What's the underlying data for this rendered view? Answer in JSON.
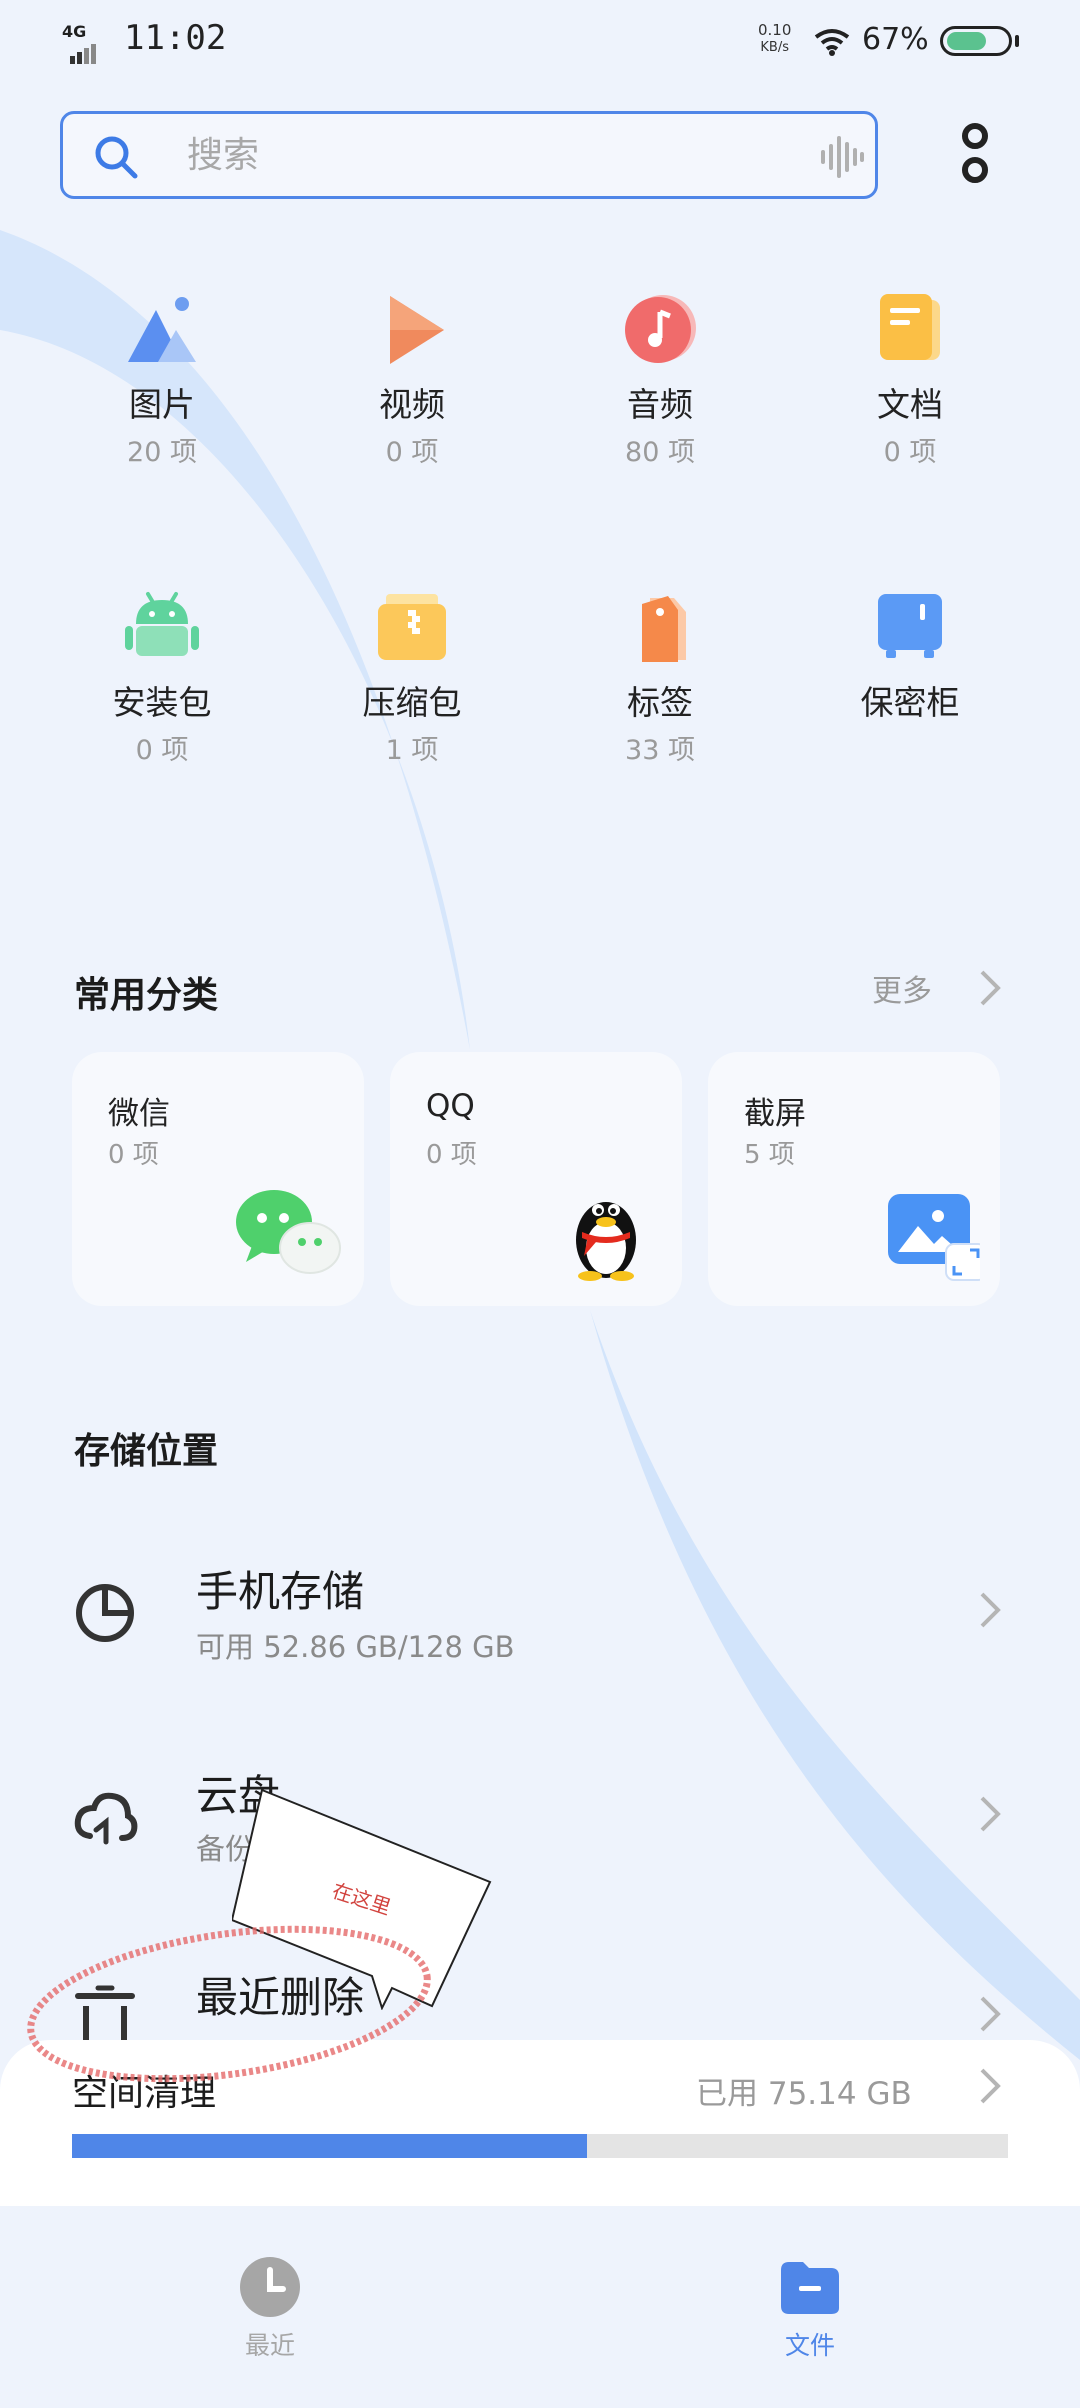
{
  "status_bar": {
    "network": "4G",
    "time": "11:02",
    "speed_value": "0.10",
    "speed_unit": "KB/s",
    "battery_pct": "67%",
    "battery_level": 0.67
  },
  "search": {
    "placeholder": "搜索"
  },
  "categories": [
    {
      "label": "图片",
      "count": "20 项",
      "icon": "image-icon"
    },
    {
      "label": "视频",
      "count": "0 项",
      "icon": "video-icon"
    },
    {
      "label": "音频",
      "count": "80 项",
      "icon": "audio-icon"
    },
    {
      "label": "文档",
      "count": "0 项",
      "icon": "document-icon"
    },
    {
      "label": "安装包",
      "count": "0 项",
      "icon": "android-icon"
    },
    {
      "label": "压缩包",
      "count": "1 项",
      "icon": "zip-icon"
    },
    {
      "label": "标签",
      "count": "33 项",
      "icon": "tag-icon"
    },
    {
      "label": "保密柜",
      "count": "",
      "icon": "safe-icon"
    }
  ],
  "common": {
    "title": "常用分类",
    "more": "更多",
    "cards": [
      {
        "title": "微信",
        "count": "0 项",
        "icon": "wechat-icon"
      },
      {
        "title": "QQ",
        "count": "0 项",
        "icon": "qq-icon"
      },
      {
        "title": "截屏",
        "count": "5 项",
        "icon": "screenshot-icon"
      }
    ]
  },
  "storage": {
    "title": "存储位置",
    "items": [
      {
        "title": "手机存储",
        "subtitle": "可用 52.86 GB/128 GB",
        "icon": "pie-chart-icon"
      },
      {
        "title": "云盘",
        "subtitle": "备份",
        "icon": "cloud-sync-icon"
      },
      {
        "title": "最近删除",
        "subtitle": "",
        "icon": "trash-icon"
      }
    ]
  },
  "cleanup": {
    "title": "空间清理",
    "used": "已用 75.14 GB",
    "used_fraction": 0.55
  },
  "annotation": {
    "text": "在这里"
  },
  "bottom_nav": [
    {
      "label": "最近",
      "icon": "clock-icon",
      "color": "#a6a6a6"
    },
    {
      "label": "文件",
      "icon": "folder-icon",
      "color": "#4f86e8"
    }
  ],
  "colors": {
    "accent": "#4f86e8",
    "background": "#eef3fc",
    "annotation": "#d2443f"
  }
}
